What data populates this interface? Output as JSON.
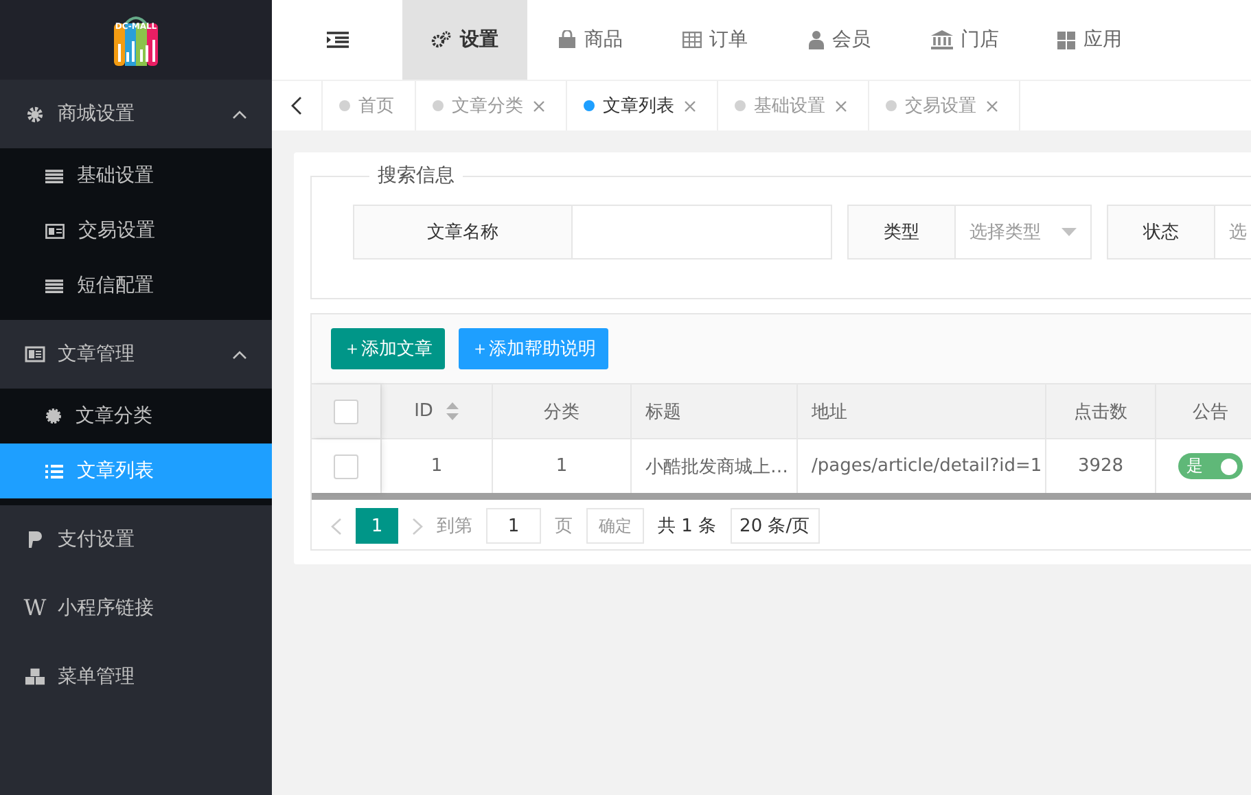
{
  "logo": {
    "text": "DC-MALL"
  },
  "sidebar": {
    "items": [
      {
        "label": "商城设置",
        "expanded": true,
        "children": [
          {
            "label": "基础设置",
            "selected": false
          },
          {
            "label": "交易设置",
            "selected": false
          },
          {
            "label": "短信配置",
            "selected": false
          }
        ]
      },
      {
        "label": "文章管理",
        "expanded": true,
        "children": [
          {
            "label": "文章分类",
            "selected": false
          },
          {
            "label": "文章列表",
            "selected": true
          }
        ]
      },
      {
        "label": "支付设置"
      },
      {
        "label": "小程序链接",
        "glyph": "W"
      },
      {
        "label": "菜单管理"
      }
    ]
  },
  "top_nav": {
    "items": [
      {
        "label": "设置",
        "selected": true
      },
      {
        "label": "商品",
        "selected": false
      },
      {
        "label": "订单",
        "selected": false
      },
      {
        "label": "会员",
        "selected": false
      },
      {
        "label": "门店",
        "selected": false
      },
      {
        "label": "应用",
        "selected": false
      }
    ]
  },
  "page_tabs": [
    {
      "label": "首页",
      "closable": false,
      "selected": false
    },
    {
      "label": "文章分类",
      "closable": true,
      "selected": false
    },
    {
      "label": "文章列表",
      "closable": true,
      "selected": true
    },
    {
      "label": "基础设置",
      "closable": true,
      "selected": false
    },
    {
      "label": "交易设置",
      "closable": true,
      "selected": false
    }
  ],
  "search": {
    "legend": "搜索信息",
    "fields": [
      {
        "kind": "input",
        "label": "文章名称"
      },
      {
        "kind": "select",
        "label": "类型",
        "placeholder": "选择类型"
      },
      {
        "kind": "select",
        "label": "状态",
        "placeholder": "选"
      }
    ]
  },
  "toolbar": {
    "buttons": [
      {
        "label": "＋添加文章",
        "kind": "primary"
      },
      {
        "label": "＋添加帮助说明",
        "kind": "info"
      }
    ]
  },
  "table": {
    "columns": [
      {
        "label": "ID",
        "sortable": true
      },
      {
        "label": "分类",
        "sortable": false
      },
      {
        "label": "标题",
        "sortable": false
      },
      {
        "label": "地址",
        "sortable": false
      },
      {
        "label": "点击数",
        "sortable": false
      },
      {
        "label": "公告",
        "sortable": false
      }
    ],
    "header_checked": false,
    "rows": [
      {
        "checked": false,
        "cells": [
          "1",
          "1",
          "小酷批发商城上…",
          "/pages/article/detail?id=1",
          "3928"
        ],
        "notice": {
          "label": "是",
          "on": true
        }
      }
    ]
  },
  "pagination": {
    "pages": [
      {
        "label": "1",
        "selected": true
      }
    ],
    "goto_label": "到第",
    "goto_value": "1",
    "page_unit": "页",
    "confirm": "确定",
    "total": "共 1 条",
    "page_size": "20 条/页"
  }
}
